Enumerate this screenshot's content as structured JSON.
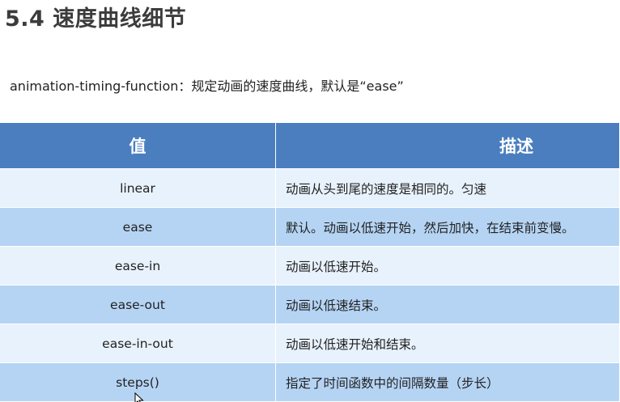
{
  "heading": "5.4 速度曲线细节",
  "description": "animation-timing-function：规定动画的速度曲线，默认是“ease”",
  "table": {
    "headers": [
      "值",
      "描述"
    ],
    "rows": [
      {
        "value": "linear",
        "desc": "动画从头到尾的速度是相同的。匀速"
      },
      {
        "value": "ease",
        "desc": "默认。动画以低速开始，然后加快，在结束前变慢。"
      },
      {
        "value": "ease-in",
        "desc": "动画以低速开始。"
      },
      {
        "value": "ease-out",
        "desc": "动画以低速结束。"
      },
      {
        "value": "ease-in-out",
        "desc": "动画以低速开始和结束。"
      },
      {
        "value": "steps()",
        "desc": "指定了时间函数中的间隔数量（步长）"
      }
    ]
  },
  "colors": {
    "header_bg": "#4a7ebf",
    "row_light": "#e8f2fc",
    "row_dark": "#b5d4f4"
  },
  "icons": {
    "cursor": "mouse-pointer-icon"
  }
}
